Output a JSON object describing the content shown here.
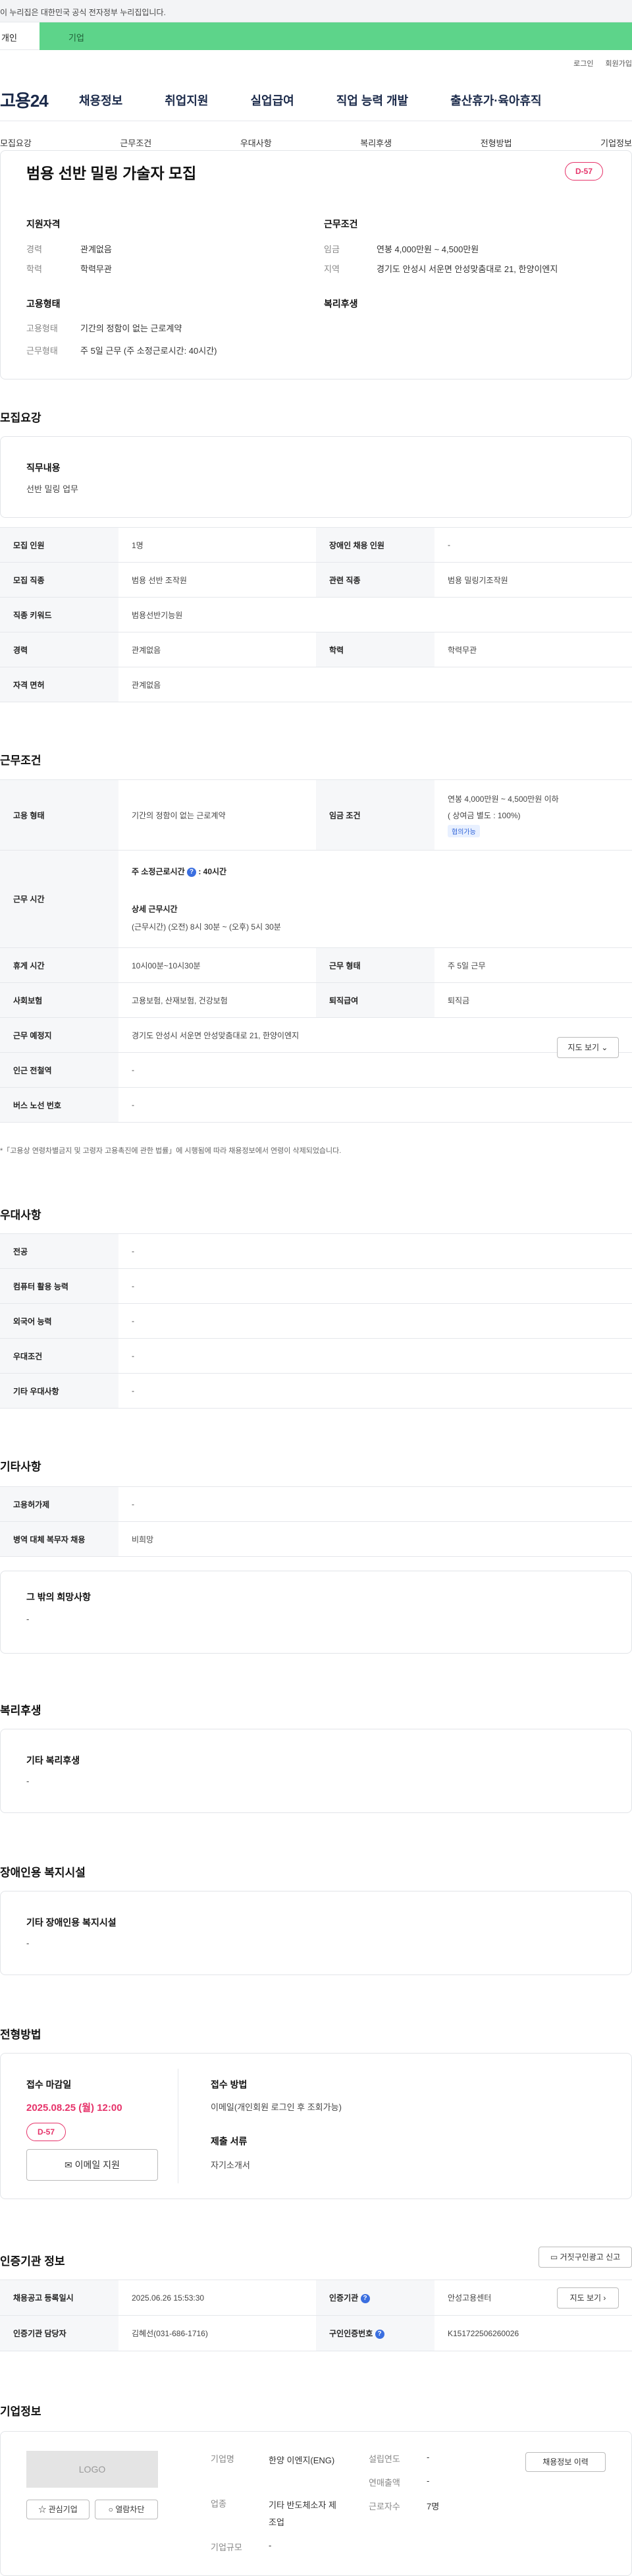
{
  "gov_bar": {
    "text": "이 누리집은 대한민국 공식 전자정부 누리집입니다."
  },
  "user_tabs": {
    "personal": "개인",
    "company": "기업"
  },
  "top_links": {
    "login": "로그인",
    "signup": "회원가입"
  },
  "gnb": {
    "logo": "고용24",
    "items": [
      "채용정보",
      "취업지원",
      "실업급여",
      "직업 능력 개발",
      "출산휴가·육아휴직"
    ]
  },
  "lnb": {
    "items": [
      "모집요강",
      "근무조건",
      "우대사항",
      "복리후생",
      "전형방법",
      "기업정보"
    ]
  },
  "summary": {
    "title": "범용 선반 밀링 가술자 모집",
    "dday": "D-57",
    "qualification": {
      "heading": "지원자격",
      "career_key": "경력",
      "career_val": "관계없음",
      "edu_key": "학력",
      "edu_val": "학력무관"
    },
    "conditions": {
      "heading": "근무조건",
      "wage_key": "임금",
      "wage_val": "연봉 4,000만원 ~ 4,500만원",
      "region_key": "지역",
      "region_val": "경기도 안성시 서운면 안성맞춤대로 21, 한양이엔지"
    },
    "employment": {
      "heading": "고용형태",
      "type_key": "고용형태",
      "type_val": "기간의 정함이 없는 근로계약",
      "work_key": "근무형태",
      "work_val": "주 5일 근무 (주 소정근로시간: 40시간)"
    },
    "welfare": {
      "heading": "복리후생"
    }
  },
  "recruit": {
    "heading": "모집요강",
    "duty_title": "직무내용",
    "duty_text": "선반 밀링 업무",
    "rows": [
      {
        "k1": "모집 인원",
        "v1": "1명",
        "k2": "장애인 채용 인원",
        "v2": "-"
      },
      {
        "k1": "모집 직종",
        "v1": "범용 선반 조작원",
        "k2": "관련 직종",
        "v2": "범용 밀링기조작원"
      },
      {
        "k1": "직종 키워드",
        "v1": "범용선반기능원"
      },
      {
        "k1": "경력",
        "v1": "관계없음",
        "k2": "학력",
        "v2": "학력무관"
      },
      {
        "k1": "자격 면허",
        "v1": "관계없음"
      }
    ]
  },
  "work": {
    "heading": "근무조건",
    "employ_k": "고용 형태",
    "employ_v": "기간의 정함이 없는 근로계약",
    "wage_k": "임금 조건",
    "wage_v": "연봉 4,000만원 ~ 4,500만원 이하",
    "wage_note": "( 상여금 별도 : 100%)",
    "wage_badge": "협의가능",
    "time_k": "근무 시간",
    "hours_label": "주 소정근로시간",
    "hours_val": ": 40시간",
    "detail_label": "상세 근무시간",
    "detail_val": "(근무시간) (오전) 8시 30분 ~ (오후) 5시 30분",
    "rest_k": "휴게 시간",
    "rest_v": "10시00분~10시30분",
    "form_k": "근무 형태",
    "form_v": "주 5일 근무",
    "insur_k": "사회보험",
    "insur_v": "고용보험, 산재보험, 건강보험",
    "sev_k": "퇴직급여",
    "sev_v": "퇴직금",
    "place_k": "근무 예정지",
    "place_v": "경기도 안성시 서운면 안성맞춤대로 21, 한양이엔지",
    "map_btn": "지도 보기",
    "station_k": "인근 전철역",
    "station_v": "-",
    "bus_k": "버스 노선 번호",
    "bus_v": "-",
    "footnote": "*「고용상 연령차별금지 및 고령자 고용촉진에 관한 법률」에 시행됨에 따라 채용정보에서 연령이 삭제되었습니다."
  },
  "preference": {
    "heading": "우대사항",
    "rows": [
      {
        "k": "전공",
        "v": "-"
      },
      {
        "k": "컴퓨터 활용 능력",
        "v": "-"
      },
      {
        "k": "외국어 능력",
        "v": "-"
      },
      {
        "k": "우대조건",
        "v": "-"
      },
      {
        "k": "기타 우대사항",
        "v": "-"
      }
    ]
  },
  "etc": {
    "heading": "기타사항",
    "rows": [
      {
        "k": "고용허가제",
        "v": "-"
      },
      {
        "k": "병역 대체 복무자 채용",
        "v": "비희망"
      }
    ],
    "box_title": "그 밖의 희망사항",
    "box_text": "-"
  },
  "welfare": {
    "heading": "복리후생",
    "box_title": "기타 복리후생",
    "box_text": "-"
  },
  "disabled": {
    "heading": "장애인용 복지시설",
    "box_title": "기타 장애인용 복지시설",
    "box_text": "-"
  },
  "selection": {
    "heading": "전형방법",
    "deadline_label": "접수 마감일",
    "deadline": "2025.08.25 (월) 12:00",
    "dday": "D-57",
    "email_btn": "이메일 지원",
    "method_label": "접수 방법",
    "method_val": "이메일(개인회원 로그인 후 조회가능)",
    "docs_label": "제출 서류",
    "docs_val": "자기소개서"
  },
  "agency": {
    "heading": "인증기관 정보",
    "report_btn": "거짓구인광고 신고",
    "reg_k": "채용공고 등록일시",
    "reg_v": "2025.06.26 15:53:30",
    "org_k": "인증기관",
    "org_v": "안성고용센터",
    "map_btn": "지도 보기",
    "staff_k": "인증기관 담당자",
    "staff_v": "김혜선(031-686-1716)",
    "num_k": "구인인증번호",
    "num_v": "K151722506260026"
  },
  "company": {
    "heading": "기업정보",
    "logo_text": "LOGO",
    "fav_btn": "관심기업",
    "block_btn": "열람차단",
    "name_k": "기업명",
    "name_v": "한양 이엔지(ENG)",
    "industry_k": "업종",
    "industry_v": "기타 반도체소자 제조업",
    "size_k": "기업규모",
    "size_v": "-",
    "founded_k": "설립연도",
    "founded_v": "-",
    "sales_k": "연매출액",
    "sales_v": "-",
    "staff_k": "근로자수",
    "staff_v": "7명",
    "history_btn": "채용정보 이력"
  }
}
